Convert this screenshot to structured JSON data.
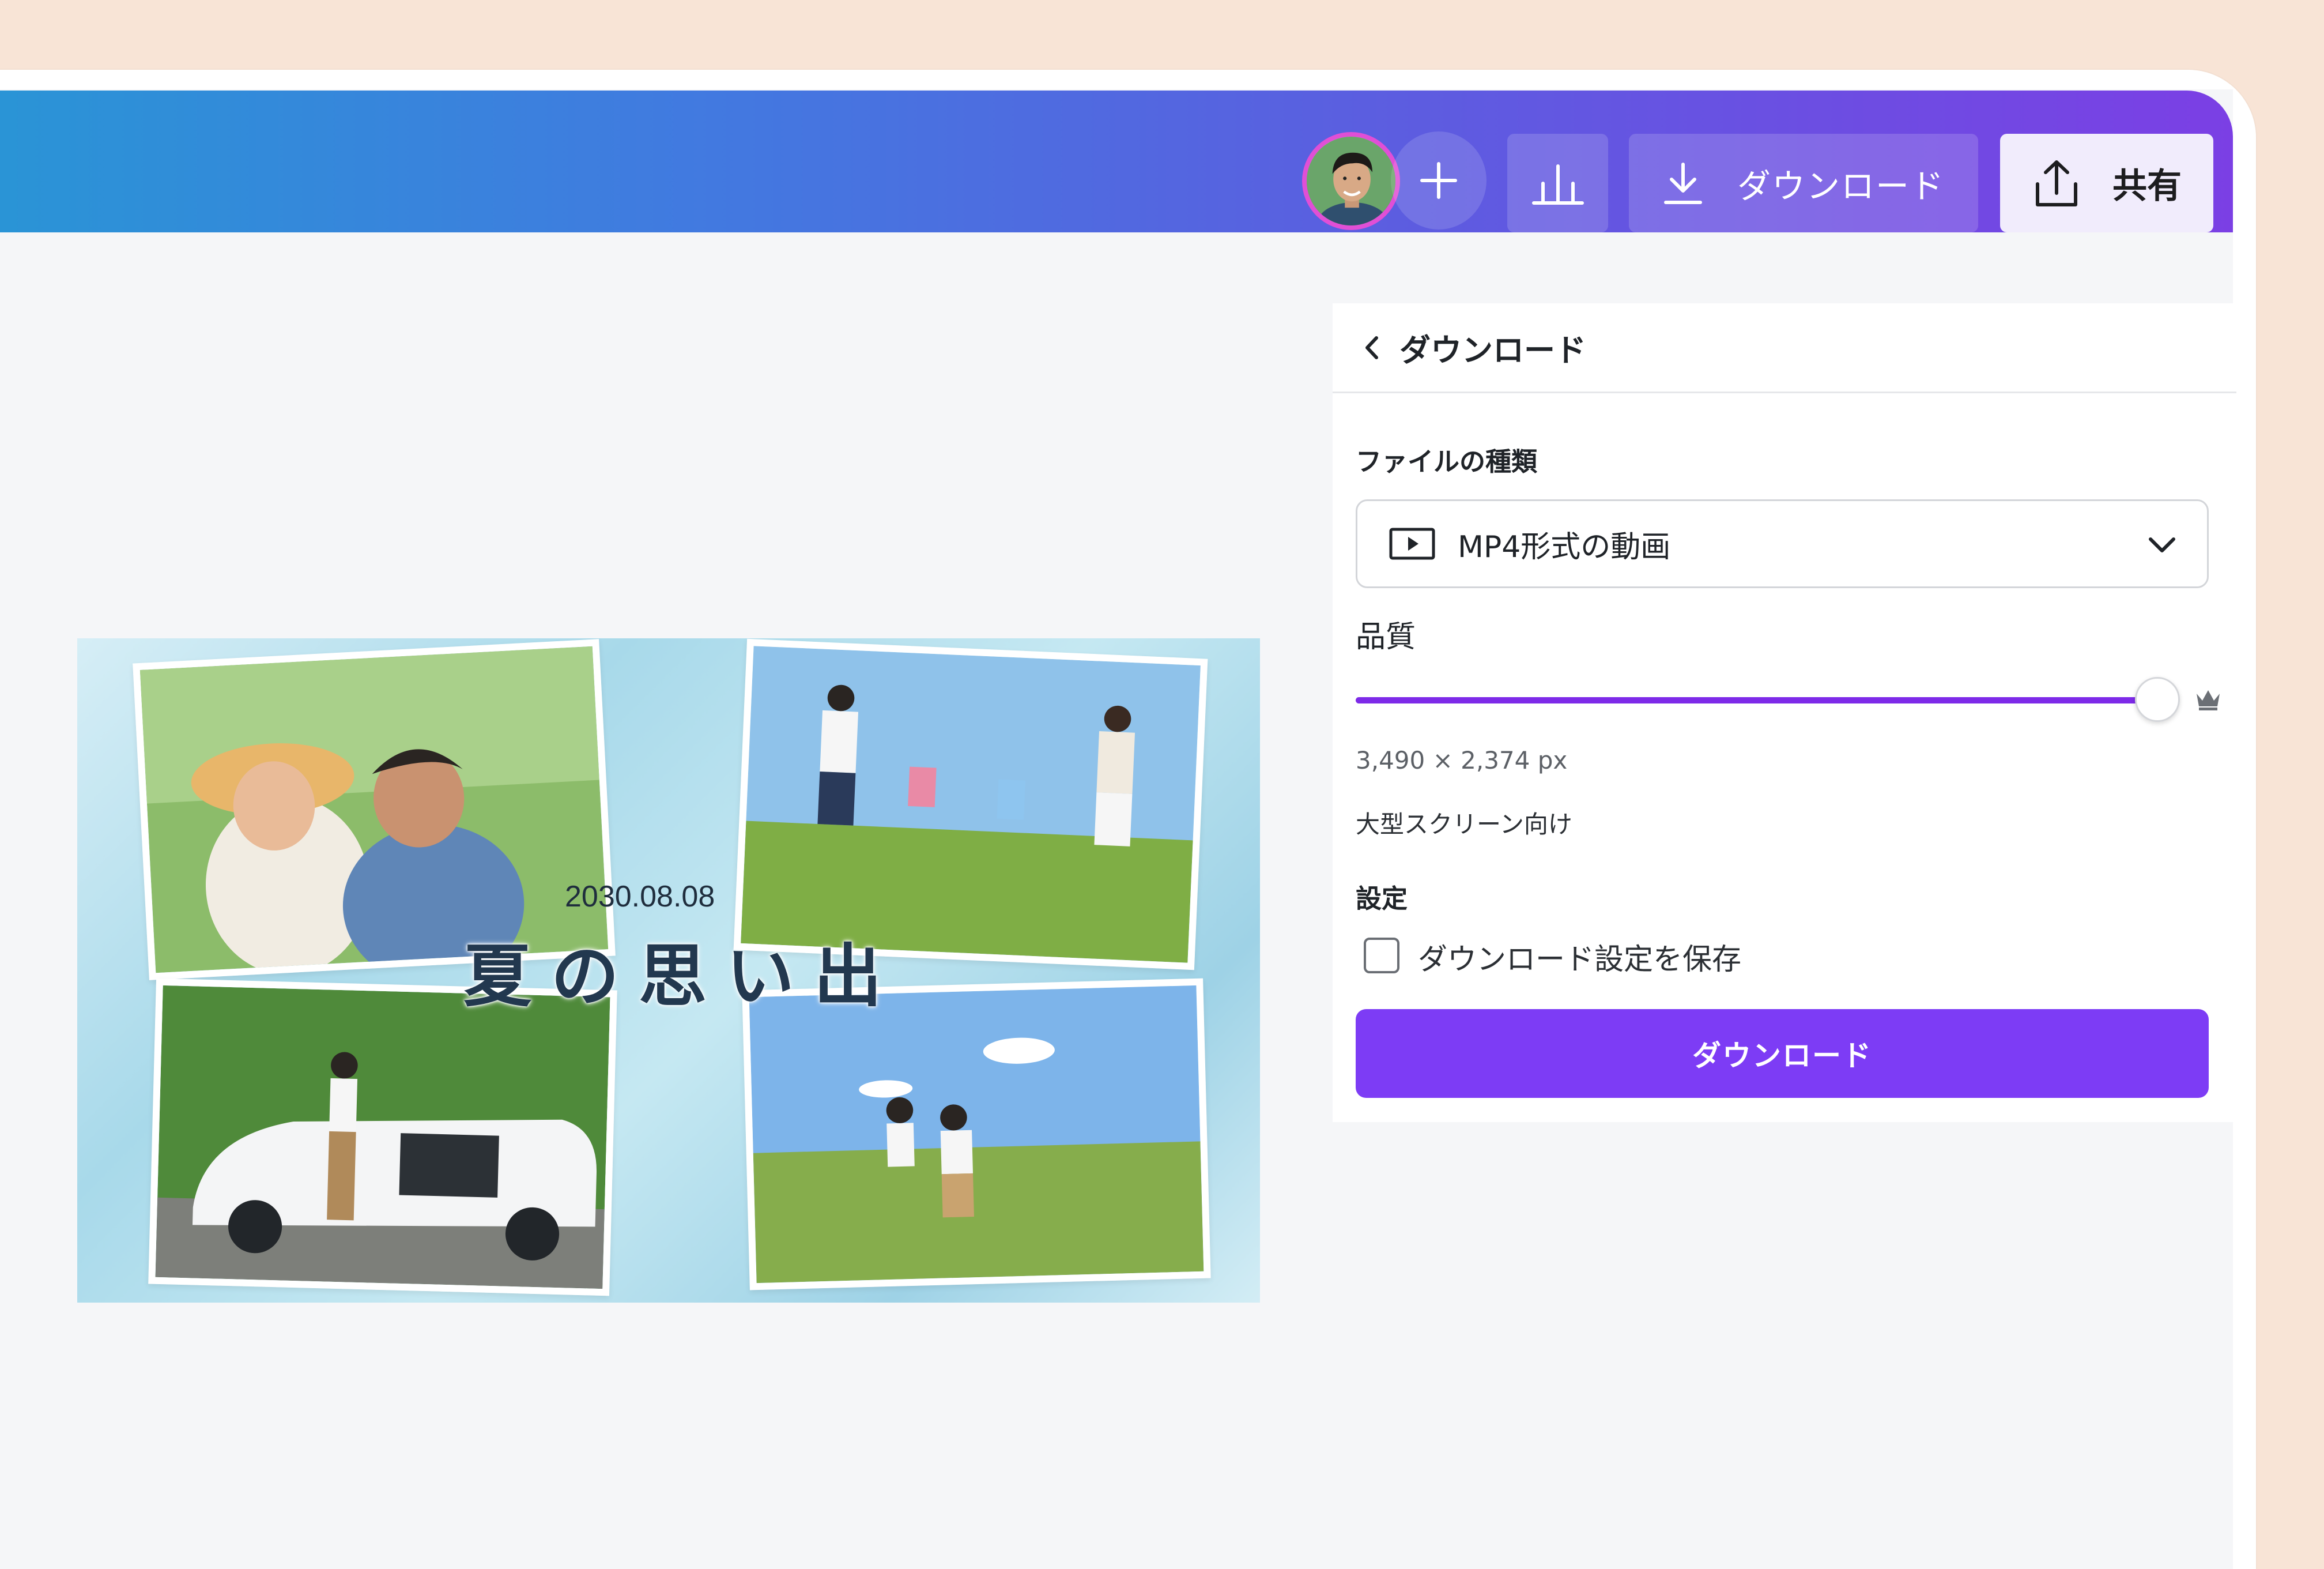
{
  "header": {
    "add_label": "+",
    "download_label": "ダウンロード",
    "share_label": "共有",
    "gradient_start": "#2a94d6",
    "gradient_end": "#7b3fe4"
  },
  "icons": {
    "add": "plus-icon",
    "stats": "bar-chart-icon",
    "download": "download-icon",
    "share": "upload-share-icon",
    "back": "chevron-left-icon",
    "video": "video-file-icon",
    "dropdown": "chevron-down-icon",
    "premium": "crown-icon"
  },
  "panel": {
    "title": "ダウンロード",
    "file_type_label": "ファイルの種類",
    "file_type_value": "MP4形式の動画",
    "quality_label": "品質",
    "quality_value": 1.0,
    "dimensions": "3,490 × 2,374 px",
    "quality_hint": "大型スクリーン向け",
    "settings_label": "設定",
    "save_settings_label": "ダウンロード設定を保存",
    "save_settings_checked": false,
    "download_button": "ダウンロード",
    "accent_color": "#7d3cf5"
  },
  "canvas": {
    "date": "2030.08.08",
    "title": "夏の思い出"
  }
}
